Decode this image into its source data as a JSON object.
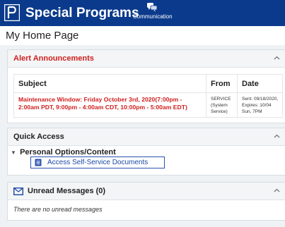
{
  "header": {
    "app_title": "Special Programs",
    "nav_item": "Communication",
    "colors": {
      "bar": "#0b3a8c"
    }
  },
  "page": {
    "title": "My Home Page"
  },
  "alerts": {
    "title": "Alert Announcements",
    "columns": [
      "Subject",
      "From",
      "Date"
    ],
    "rows": [
      {
        "subject": "Maintenance Window: Friday October 3rd, 2020(7:00pm - 2:00am PDT, 9:00pm - 4:00am CDT, 10:00pm - 5:00am EDT)",
        "from": "SERVICE (System Service)",
        "date_sent": "Sent: 09/18/2020,",
        "date_expires": "Expires: 10/04 Sun, 7PM"
      }
    ],
    "colors": {
      "title": "#d01f1f"
    }
  },
  "quick_access": {
    "title": "Quick Access",
    "group_label": "Personal Options/Content",
    "link_label": "Access Self-Service Documents"
  },
  "messages": {
    "title": "Unread Messages (0)",
    "empty_text": "There are no unread messages"
  }
}
